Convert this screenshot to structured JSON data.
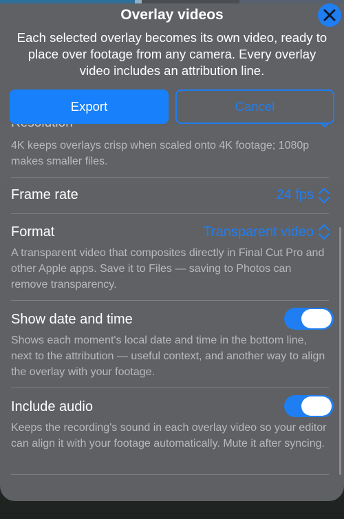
{
  "sheet": {
    "title": "Overlay videos",
    "subtitle": "Each selected overlay becomes its own video, ready to place over footage from any camera. Every overlay video includes an attribution line.",
    "export_label": "Export",
    "cancel_label": "Cancel"
  },
  "settings": {
    "resolution": {
      "label": "Resolution",
      "description": "4K keeps overlays crisp when scaled onto 4K footage; 1080p makes smaller files."
    },
    "frame_rate": {
      "label": "Frame rate",
      "value": "24 fps"
    },
    "format": {
      "label": "Format",
      "value": "Transparent video",
      "description": "A transparent video that composites directly in Final Cut Pro and other Apple apps. Save it to Files — saving to Photos can remove transparency."
    },
    "show_date_time": {
      "label": "Show date and time",
      "enabled": true,
      "description": "Shows each moment's local date and time in the bottom line, next to the attribution — useful context, and another way to align the overlay with your footage."
    },
    "include_audio": {
      "label": "Include audio",
      "enabled": true,
      "description": "Keeps the recording's sound in each overlay video so your editor can align it with your footage automatically. Mute it after syncing."
    }
  },
  "colors": {
    "accent": "#1f7ef2",
    "sheet": "#636467",
    "secondary_text": "#b8b9bd"
  }
}
